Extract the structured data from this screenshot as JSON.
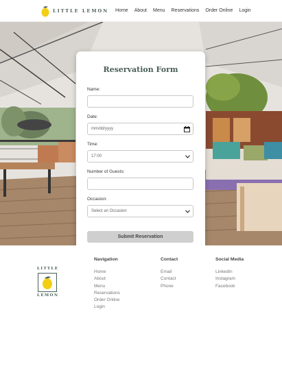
{
  "header": {
    "logo_text": "LITTLE LEMON",
    "nav": [
      "Home",
      "About",
      "Menu",
      "Reservations",
      "Order Online",
      "Login"
    ]
  },
  "form": {
    "title": "Reservation Form",
    "name_label": "Name:",
    "name_value": "",
    "date_label": "Date:",
    "date_placeholder": "mm/dd/yyyy",
    "time_label": "Time:",
    "time_value": "17:00",
    "guests_label": "Number of Guests:",
    "guests_value": "",
    "occasion_label": "Occasion:",
    "occasion_value": "Select an Occasion",
    "submit_label": "Submit Reservation"
  },
  "footer": {
    "logo_top": "LITTLE",
    "logo_bottom": "LEMON",
    "navigation": {
      "heading": "Navigation",
      "items": [
        "Home",
        "About",
        "Menu",
        "Reservations",
        "Order Online",
        "Login"
      ]
    },
    "contact": {
      "heading": "Contact",
      "items": [
        "Email",
        "Contact",
        "Phone"
      ]
    },
    "social": {
      "heading": "Social Media",
      "items": [
        "LinkedIn",
        "Instagram",
        "Facebook"
      ]
    }
  },
  "colors": {
    "brand_green": "#495e57",
    "lemon": "#f4ce14",
    "submit_bg": "#cfcfcf"
  },
  "icons": [
    "lemon-logo",
    "calendar-icon",
    "chevron-down-icon"
  ]
}
